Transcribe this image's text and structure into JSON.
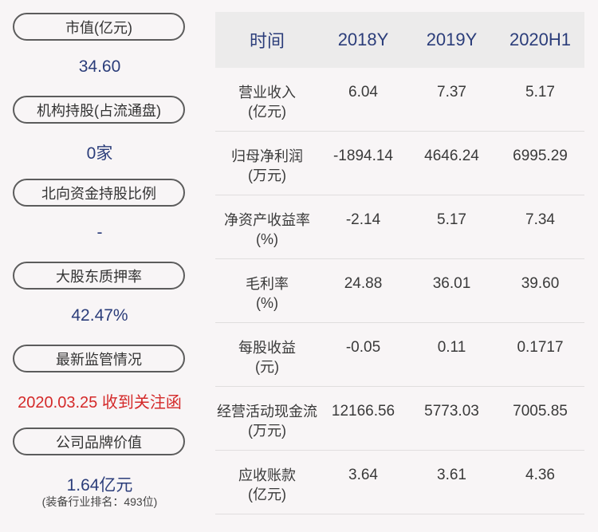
{
  "left_panel": {
    "items": [
      {
        "label": "市值(亿元)",
        "value": "34.60"
      },
      {
        "label": "机构持股(占流通盘)",
        "value": "0家"
      },
      {
        "label": "北向资金持股比例",
        "value": "-"
      },
      {
        "label": "大股东质押率",
        "value": "42.47%"
      },
      {
        "label": "最新监管情况",
        "value": "2020.03.25 收到关注函"
      },
      {
        "label": "公司品牌价值",
        "value": "1.64亿元",
        "note": "(装备行业排名：493位)"
      }
    ]
  },
  "table": {
    "headers": [
      "时间",
      "2018Y",
      "2019Y",
      "2020H1"
    ],
    "rows": [
      {
        "label_line1": "营业收入",
        "label_line2": "(亿元)",
        "values": [
          "6.04",
          "7.37",
          "5.17"
        ]
      },
      {
        "label_line1": "归母净利润",
        "label_line2": "(万元)",
        "values": [
          "-1894.14",
          "4646.24",
          "6995.29"
        ]
      },
      {
        "label_line1": "净资产收益率",
        "label_line2": "(%)",
        "values": [
          "-2.14",
          "5.17",
          "7.34"
        ]
      },
      {
        "label_line1": "毛利率",
        "label_line2": "(%)",
        "values": [
          "24.88",
          "36.01",
          "39.60"
        ]
      },
      {
        "label_line1": "每股收益",
        "label_line2": "(元)",
        "values": [
          "-0.05",
          "0.11",
          "0.1717"
        ]
      },
      {
        "label_line1": "经营活动现金流",
        "label_line2": "(万元)",
        "values": [
          "12166.56",
          "5773.03",
          "7005.85"
        ]
      },
      {
        "label_line1": "应收账款",
        "label_line2": "(亿元)",
        "values": [
          "3.64",
          "3.61",
          "4.36"
        ]
      }
    ]
  },
  "colors": {
    "background": "#f8f5f6",
    "header_bg": "#ecebeb",
    "accent_blue": "#2b3d7a",
    "alert_red": "#d42a2a"
  }
}
